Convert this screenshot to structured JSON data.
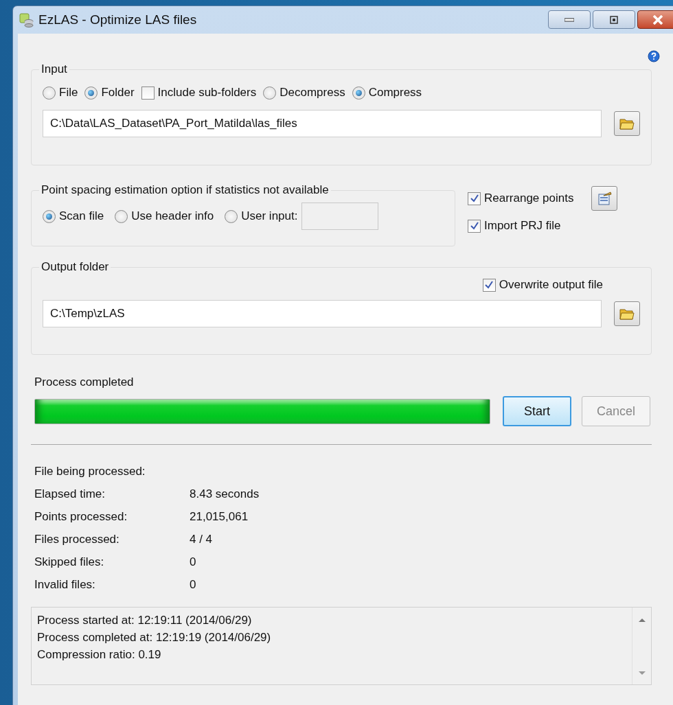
{
  "window": {
    "title": "EzLAS - Optimize LAS files"
  },
  "input": {
    "legend": "Input",
    "options": [
      {
        "kind": "radio",
        "label": "File",
        "selected": false
      },
      {
        "kind": "radio",
        "label": "Folder",
        "selected": true
      },
      {
        "kind": "checkbox",
        "label": "Include sub-folders",
        "checked": false
      },
      {
        "kind": "radio",
        "label": "Decompress",
        "selected": false
      },
      {
        "kind": "radio",
        "label": "Compress",
        "selected": true
      }
    ],
    "path": "C:\\Data\\LAS_Dataset\\PA_Port_Matilda\\las_files"
  },
  "spacing": {
    "legend": "Point spacing estimation option if statistics not available",
    "options": [
      {
        "label": "Scan file",
        "selected": true
      },
      {
        "label": "Use header info",
        "selected": false
      },
      {
        "label": "User input:",
        "selected": false
      }
    ]
  },
  "flags": [
    {
      "label": "Rearrange points",
      "checked": true
    },
    {
      "label": "Import PRJ file",
      "checked": true
    }
  ],
  "output": {
    "legend": "Output folder",
    "overwrite": {
      "label": "Overwrite output file",
      "checked": true
    },
    "path": "C:\\Temp\\zLAS"
  },
  "progress": {
    "status": "Process completed",
    "level": 1.0
  },
  "buttons": [
    {
      "label": "Start",
      "disabled": false
    },
    {
      "label": "Cancel",
      "disabled": true
    }
  ],
  "stats": [
    {
      "label": "File being processed:"
    },
    {
      "label": "Elapsed time:",
      "value": "8.43 seconds"
    },
    {
      "label": "Points processed:",
      "value": "21,015,061"
    },
    {
      "label": "Files processed:",
      "value": "4 / 4"
    },
    {
      "label": "Skipped files:",
      "value": "0"
    },
    {
      "label": "Invalid files:",
      "value": "0"
    }
  ],
  "log": [
    "Process started at: 12:19:11 (2014/06/29)",
    "Process completed at: 12:19:19 (2014/06/29)",
    "Compression ratio: 0.19"
  ]
}
